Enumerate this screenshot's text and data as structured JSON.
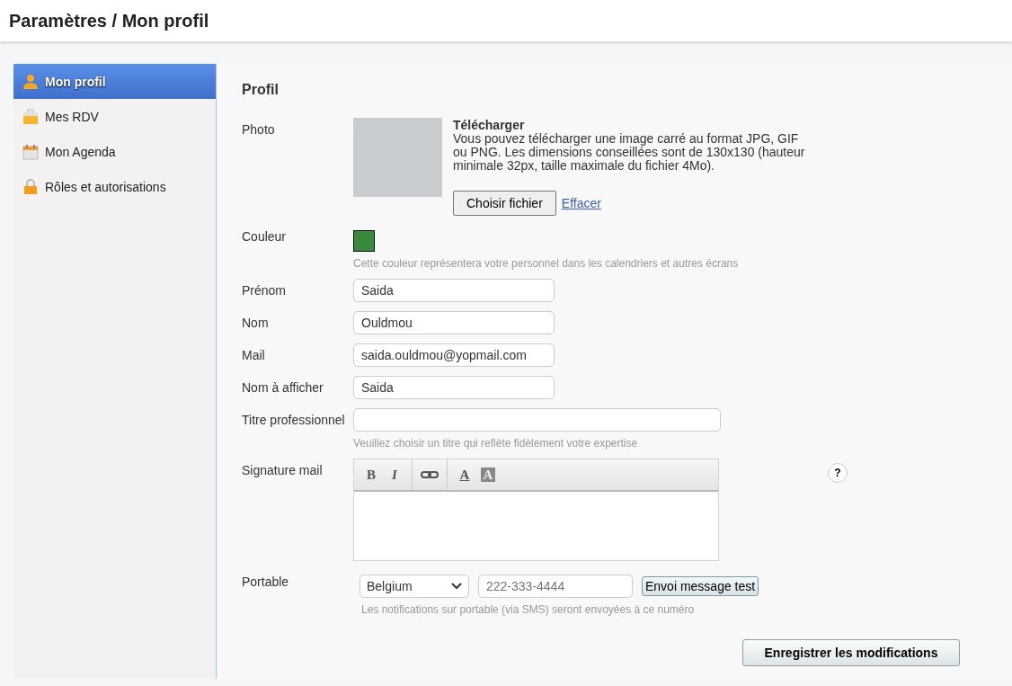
{
  "header": {
    "title": "Paramètres / Mon profil"
  },
  "sidebar": {
    "items": [
      {
        "label": "Mon profil",
        "selected": true
      },
      {
        "label": "Mes RDV",
        "selected": false
      },
      {
        "label": "Mon Agenda",
        "selected": false
      },
      {
        "label": "Rôles et autorisations",
        "selected": false
      }
    ]
  },
  "section_title": "Profil",
  "photo": {
    "label": "Photo",
    "upload_title": "Télécharger",
    "upload_text": "Vous pouvez télécharger une image carré au format JPG, GIF ou PNG. Les dimensions conseillées sont de 130x130 (hauteur minimale 32px, taille maximale du fichier 4Mo).",
    "choose_button": "Choisir fichier",
    "clear_link": "Effacer"
  },
  "color_field": {
    "label": "Couleur",
    "color": "#3a8a3e",
    "hint": "Cette couleur représentera votre personnel dans les calendriers et autres écrans"
  },
  "fields": [
    {
      "label": "Prénom",
      "value": "Saida",
      "wide": false
    },
    {
      "label": "Nom",
      "value": "Ouldmou",
      "wide": false
    },
    {
      "label": "Mail",
      "value": "saida.ouldmou@yopmail.com",
      "wide": false
    },
    {
      "label": "Nom à afficher",
      "value": "Saida",
      "wide": false
    },
    {
      "label": "Titre professionnel",
      "wide": true,
      "hint": "Veuillez choisir un titre qui reflète fidèlement votre expertise"
    }
  ],
  "signature": {
    "label": "Signature mail",
    "toolbar": [
      {
        "kind": "bold",
        "text": "B"
      },
      {
        "kind": "italic",
        "text": "I"
      },
      {
        "kind": "link"
      },
      {
        "kind": "text-color",
        "text": "A"
      },
      {
        "kind": "bg-color",
        "text": "A"
      }
    ],
    "help": "?"
  },
  "phone": {
    "label": "Portable",
    "country": "Belgium",
    "placeholder": "222-333-4444",
    "test_button": "Envoi message test",
    "hint": "Les notifications sur portable (via SMS) seront envoyées à ce numéro"
  },
  "save_button": "Enregistrer les modifications"
}
